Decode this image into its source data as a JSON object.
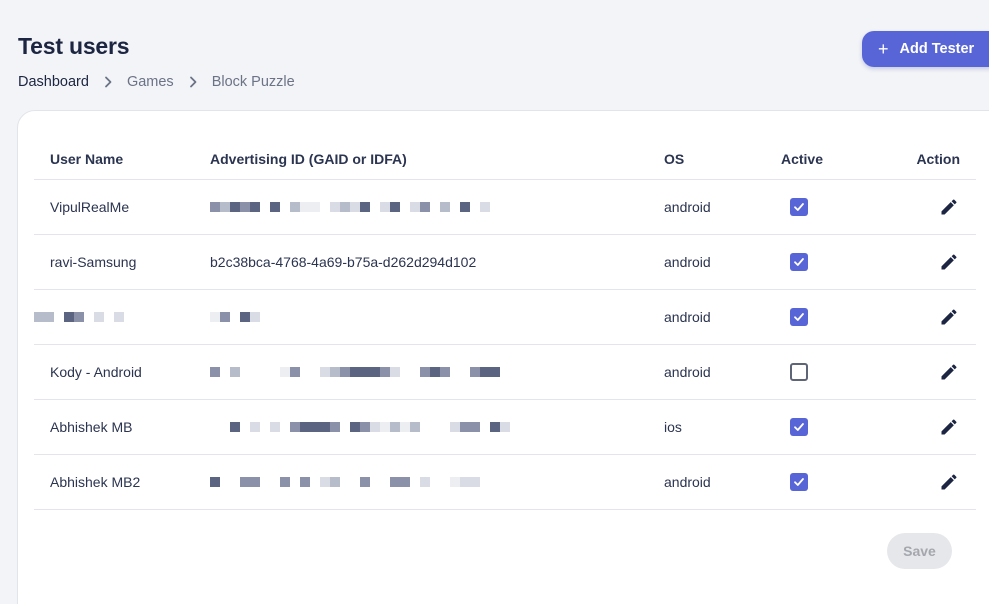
{
  "page": {
    "title": "Test users"
  },
  "breadcrumb": [
    {
      "label": "Dashboard"
    },
    {
      "label": "Games"
    },
    {
      "label": "Block Puzzle"
    }
  ],
  "add_button": {
    "label": "Add Tester",
    "icon": "plus-icon"
  },
  "table": {
    "headers": {
      "name": "User Name",
      "id": "Advertising ID (GAID or IDFA)",
      "os": "OS",
      "active": "Active",
      "action": "Action"
    },
    "rows": [
      {
        "name": "VipulRealMe",
        "name_redacted": false,
        "id": "",
        "id_redacted": true,
        "os": "android",
        "active": true
      },
      {
        "name": "ravi-Samsung",
        "name_redacted": false,
        "id": "b2c38bca-4768-4a69-b75a-d262d294d102",
        "id_redacted": false,
        "os": "android",
        "active": true
      },
      {
        "name": "",
        "name_redacted": true,
        "id": "",
        "id_redacted": true,
        "os": "android",
        "active": true
      },
      {
        "name": "Kody - Android",
        "name_redacted": false,
        "id": "",
        "id_redacted": true,
        "os": "android",
        "active": false
      },
      {
        "name": "Abhishek MB",
        "name_redacted": false,
        "id": "",
        "id_redacted": true,
        "os": "ios",
        "active": true
      },
      {
        "name": "Abhishek MB2",
        "name_redacted": false,
        "id": "",
        "id_redacted": true,
        "os": "android",
        "active": true
      }
    ]
  },
  "save_button": {
    "label": "Save",
    "disabled": true
  },
  "colors": {
    "accent": "#5865d6",
    "title": "#1c2541",
    "muted": "#6b7386"
  }
}
